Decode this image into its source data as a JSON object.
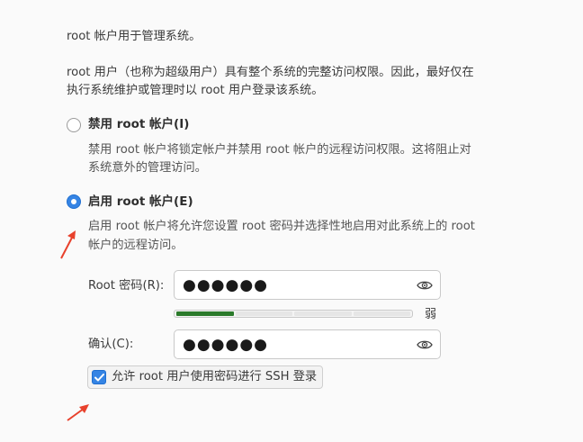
{
  "intro": {
    "line1": "root 帐户用于管理系统。",
    "line2a": "root 用户（也称为超级用户）具有整个系统的完整访问权限。因此，最好仅在",
    "line2b": "执行系统维护或管理时以 root 用户登录该系统。"
  },
  "disable_option": {
    "label": "禁用 root 帐户(I)",
    "selected": false,
    "desc_line1": "禁用 root 帐户将锁定帐户并禁用 root 帐户的远程访问权限。这将阻止对",
    "desc_line2": "系统意外的管理访问。"
  },
  "enable_option": {
    "label": "启用 root 帐户(E)",
    "selected": true,
    "desc_line1": "启用 root 帐户将允许您设置 root 密码并选择性地启用对此系统上的 root",
    "desc_line2": "帐户的远程访问。"
  },
  "password": {
    "label": "Root 密码(R):",
    "masked_value": "●●●●●●",
    "strength_fraction": 0.25,
    "strength_label": "弱"
  },
  "confirm": {
    "label": "确认(C):",
    "masked_value": "●●●●●●"
  },
  "ssh": {
    "label": "允许 root 用户使用密码进行 SSH 登录",
    "checked": true
  },
  "icons": {
    "reveal": "eye-icon",
    "check": "checkmark-icon",
    "annotation": "red-arrow-annotation"
  },
  "colors": {
    "accent": "#3584e4",
    "strength_bar": "#2b7a2b",
    "annotation": "#e8412c"
  }
}
